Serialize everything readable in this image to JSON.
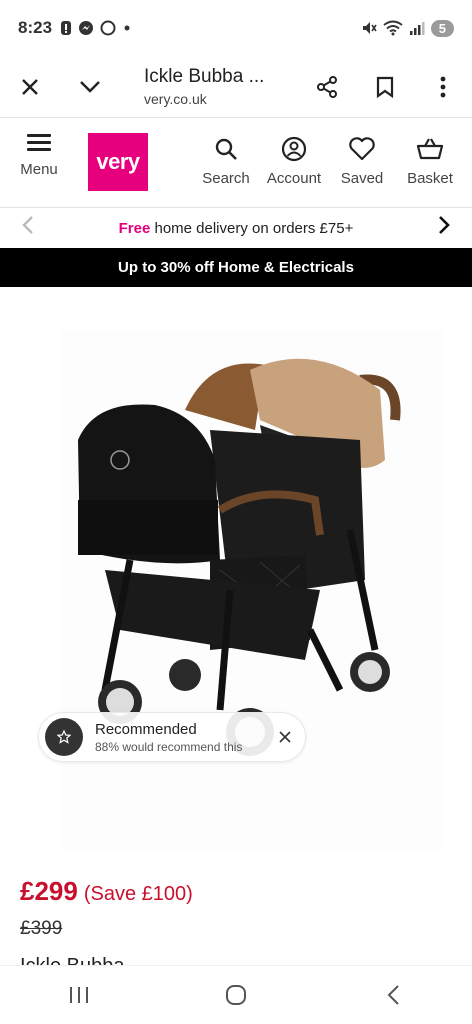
{
  "status_bar": {
    "time": "8:23",
    "battery": "5",
    "left_icons": [
      "alert-icon",
      "messenger-icon",
      "whatsapp-icon",
      "dot-icon"
    ],
    "right_icons": [
      "mute-icon",
      "wifi-icon",
      "signal-icon"
    ]
  },
  "browser": {
    "title": "Ickle Bubba ...",
    "url": "very.co.uk"
  },
  "header": {
    "menu_label": "Menu",
    "logo_text": "very",
    "nav": [
      {
        "label": "Search",
        "icon": "search-icon"
      },
      {
        "label": "Account",
        "icon": "account-icon"
      },
      {
        "label": "Saved",
        "icon": "heart-icon"
      },
      {
        "label": "Basket",
        "icon": "basket-icon"
      }
    ]
  },
  "promo": {
    "free": "Free",
    "rest": " home delivery on orders £75+"
  },
  "sale_banner": "Up to 30% off Home & Electricals",
  "toast": {
    "title": "Recommended",
    "subtitle": "88% would recommend this"
  },
  "product": {
    "price": "£299",
    "save": "(Save £100)",
    "was_price": "£399",
    "title": "Ickle Bubba"
  },
  "colors": {
    "brand": "#e6007e",
    "price": "#c8102e",
    "banner": "#000000"
  }
}
